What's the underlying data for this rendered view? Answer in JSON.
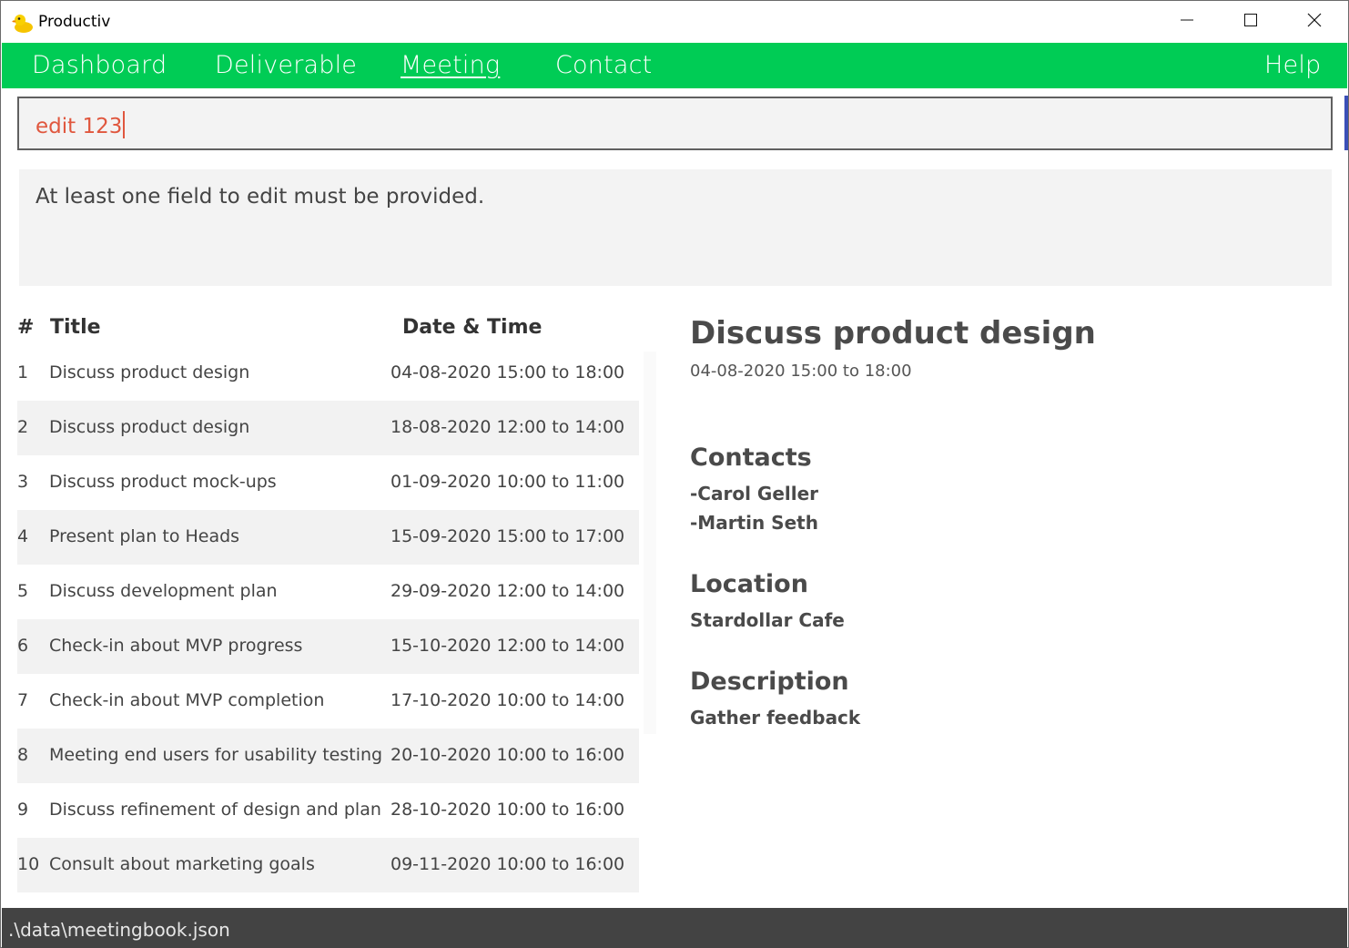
{
  "window": {
    "title": "Productiv",
    "icon": "rubber-duck-icon",
    "controls": [
      "minimize-icon",
      "maximize-icon",
      "close-icon"
    ]
  },
  "nav": {
    "items": [
      "Dashboard",
      "Deliverable",
      "Meeting",
      "Contact"
    ],
    "active": "Meeting",
    "help": "Help",
    "color": "#00cc55"
  },
  "command": {
    "value": "edit 123",
    "text_color": "#e0573e"
  },
  "result": {
    "message": "At least one field to edit must be provided."
  },
  "list": {
    "headers": {
      "index": "#",
      "title": "Title",
      "datetime": "Date & Time"
    },
    "rows": [
      {
        "index": "1",
        "title": "Discuss product design",
        "datetime": "04-08-2020 15:00 to 18:00"
      },
      {
        "index": "2",
        "title": "Discuss product design",
        "datetime": "18-08-2020 12:00 to 14:00"
      },
      {
        "index": "3",
        "title": "Discuss product mock-ups",
        "datetime": "01-09-2020 10:00 to 11:00"
      },
      {
        "index": "4",
        "title": "Present plan to Heads",
        "datetime": "15-09-2020 15:00 to 17:00"
      },
      {
        "index": "5",
        "title": "Discuss development plan",
        "datetime": "29-09-2020 12:00 to 14:00"
      },
      {
        "index": "6",
        "title": "Check-in about MVP progress",
        "datetime": "15-10-2020 12:00 to 14:00"
      },
      {
        "index": "7",
        "title": "Check-in about MVP completion",
        "datetime": "17-10-2020 10:00 to 14:00"
      },
      {
        "index": "8",
        "title": "Meeting end users for usability testing",
        "datetime": "20-10-2020 10:00 to 16:00"
      },
      {
        "index": "9",
        "title": "Discuss refinement of design and plan",
        "datetime": "28-10-2020 10:00 to 16:00"
      },
      {
        "index": "10",
        "title": "Consult about marketing goals",
        "datetime": "09-11-2020 10:00 to 16:00"
      }
    ]
  },
  "detail": {
    "title": "Discuss product design",
    "datetime": "04-08-2020 15:00 to 18:00",
    "contacts_label": "Contacts",
    "contacts": [
      "-Carol Geller",
      "-Martin Seth"
    ],
    "location_label": "Location",
    "location": "Stardollar Cafe",
    "description_label": "Description",
    "description": "Gather feedback"
  },
  "status": {
    "path": ".\\data\\meetingbook.json"
  }
}
